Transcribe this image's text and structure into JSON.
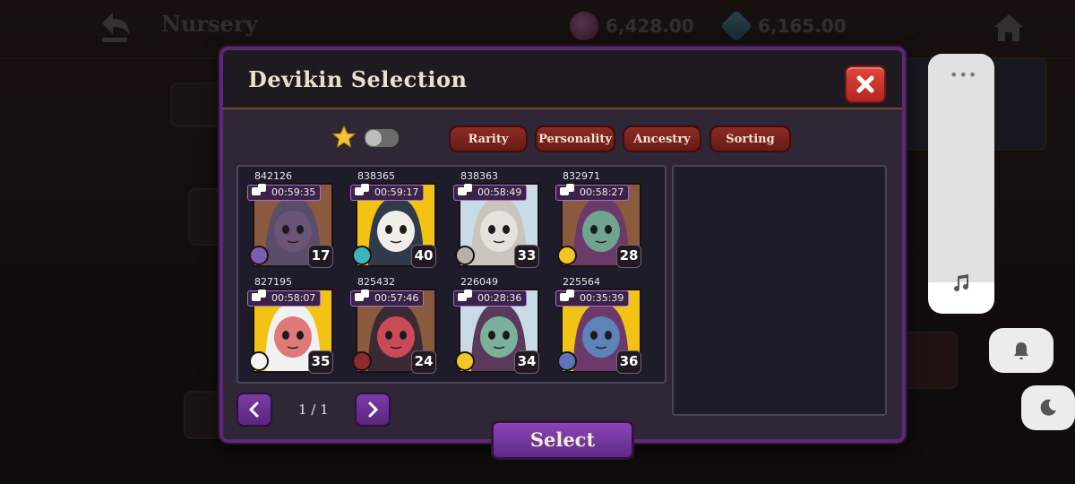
{
  "header": {
    "title": "Nursery",
    "currencies": [
      {
        "name": "gold",
        "value": "6,428.00"
      },
      {
        "name": "gem",
        "value": "6,165.00"
      }
    ]
  },
  "modal": {
    "title": "Devikin Selection",
    "filters": [
      "Rarity",
      "Personality",
      "Ancestry",
      "Sorting"
    ],
    "favorites_toggle": "off",
    "cards": [
      {
        "id": "842126",
        "timer": "00:59:35",
        "level": "17",
        "bg": "#8a5a3f",
        "skin": "#6b5577",
        "hood": "#5a4d6a",
        "badge_color": "#7a5fb0",
        "badge_icon": "heart-icon"
      },
      {
        "id": "838365",
        "timer": "00:59:17",
        "level": "40",
        "bg": "#f2c313",
        "skin": "#f0eee8",
        "hood": "#2f3a4a",
        "badge_color": "#3bb5b8",
        "badge_icon": "triangle-icon"
      },
      {
        "id": "838363",
        "timer": "00:58:49",
        "level": "33",
        "bg": "#c8dbe6",
        "skin": "#e4e2dc",
        "hood": "#c9c5bd",
        "badge_color": "#b6b2aa",
        "badge_icon": "skull-icon"
      },
      {
        "id": "832971",
        "timer": "00:58:27",
        "level": "28",
        "bg": "#8a5a3f",
        "skin": "#6fa58f",
        "hood": "#6b3a6a",
        "badge_color": "#f3c522",
        "badge_icon": "question-icon"
      },
      {
        "id": "827195",
        "timer": "00:58:07",
        "level": "35",
        "bg": "#f2c313",
        "skin": "#e07a7a",
        "hood": "#f1f1f1",
        "badge_color": "#f4f4f4",
        "badge_icon": "info-icon"
      },
      {
        "id": "825432",
        "timer": "00:57:46",
        "level": "24",
        "bg": "#8a5a3f",
        "skin": "#c94b58",
        "hood": "#3a2a34",
        "badge_color": "#8d2a2a",
        "badge_icon": "flame-icon"
      },
      {
        "id": "226049",
        "timer": "00:28:36",
        "level": "34",
        "bg": "#c8dbe6",
        "skin": "#7bb09a",
        "hood": "#5a3a5a",
        "badge_color": "#f3c522",
        "badge_icon": "question-icon"
      },
      {
        "id": "225564",
        "timer": "00:35:39",
        "level": "36",
        "bg": "#f2c313",
        "skin": "#5e83b8",
        "hood": "#6b3a6a",
        "badge_color": "#5e73b8",
        "badge_icon": "moon-icon"
      }
    ],
    "pagination": {
      "label": "1 / 1"
    },
    "select_label": "Select"
  },
  "system_panel": {
    "dots": "•••"
  }
}
